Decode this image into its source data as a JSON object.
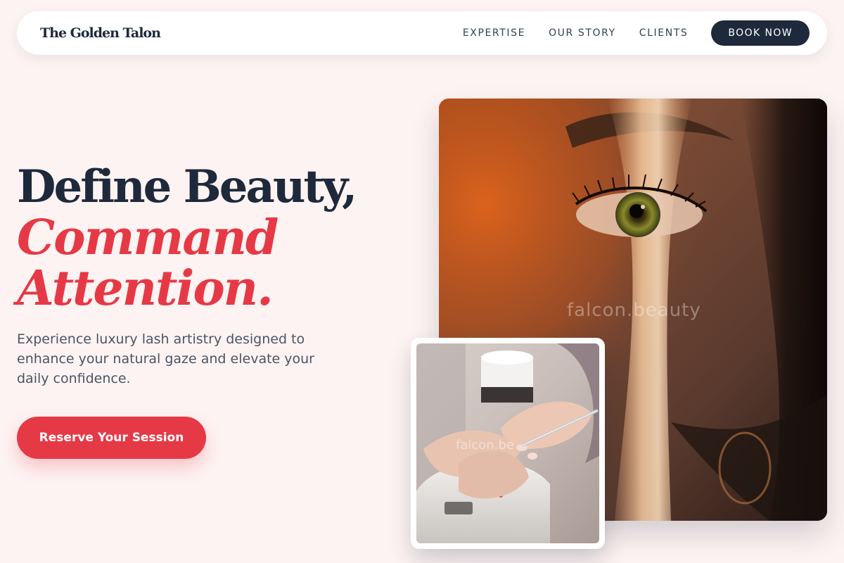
{
  "brand": {
    "name": "The Golden Talon"
  },
  "nav": {
    "links": [
      "EXPERTISE",
      "OUR STORY",
      "CLIENTS"
    ],
    "cta_label": "BOOK NOW"
  },
  "hero": {
    "title_line1": "Define Beauty,",
    "title_accent_line1": "Command",
    "title_accent_line2": "Attention.",
    "subtitle": "Experience luxury lash artistry designed to enhance your natural gaze and elevate your daily confidence.",
    "cta_label": "Reserve Your Session"
  },
  "images": {
    "main_watermark": "falcon.beauty",
    "inset_watermark": "falcon.be"
  },
  "colors": {
    "background": "#fdf3f2",
    "navy": "#1e293b",
    "accent_red": "#e63946"
  }
}
